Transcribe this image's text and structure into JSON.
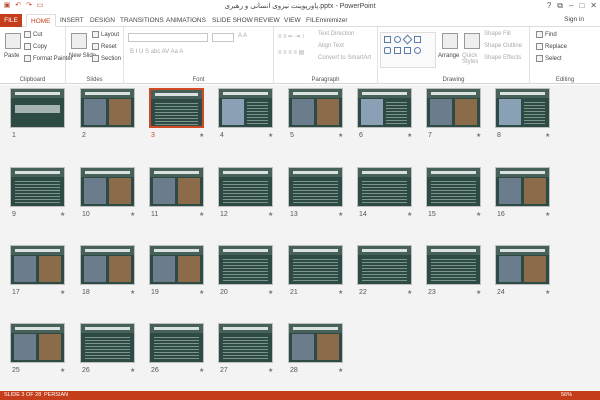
{
  "window": {
    "title": "پاورپوینت نیروی انسانی و رهبری.pptx - PowerPoint",
    "signin": "Sign in"
  },
  "qat_icons": [
    "save-icon",
    "undo-icon",
    "redo-icon",
    "present-icon"
  ],
  "tabs": [
    {
      "label": "FILE",
      "kind": "file"
    },
    {
      "label": "HOME",
      "kind": "active"
    },
    {
      "label": "INSERT"
    },
    {
      "label": "DESIGN"
    },
    {
      "label": "TRANSITIONS"
    },
    {
      "label": "ANIMATIONS"
    },
    {
      "label": "SLIDE SHOW"
    },
    {
      "label": "REVIEW"
    },
    {
      "label": "VIEW"
    },
    {
      "label": "FILEminimizer"
    }
  ],
  "ribbon": {
    "clipboard": {
      "label": "Clipboard",
      "paste": "Paste",
      "cut": "Cut",
      "copy": "Copy",
      "format_painter": "Format Painter"
    },
    "slides": {
      "label": "Slides",
      "new_slide": "New Slide",
      "layout": "Layout",
      "reset": "Reset",
      "section": "Section"
    },
    "font": {
      "label": "Font"
    },
    "paragraph": {
      "label": "Paragraph",
      "text_direction": "Text Direction",
      "align_text": "Align Text",
      "convert_smartart": "Convert to SmartArt"
    },
    "drawing": {
      "label": "Drawing",
      "arrange": "Arrange",
      "quick_styles": "Quick Styles",
      "shape_fill": "Shape Fill",
      "shape_outline": "Shape Outline",
      "shape_effects": "Shape Effects"
    },
    "editing": {
      "label": "Editing",
      "find": "Find",
      "replace": "Replace",
      "select": "Select"
    }
  },
  "slides": [
    {
      "n": "1",
      "star": false,
      "kind": "title",
      "selected": false
    },
    {
      "n": "2",
      "star": false,
      "kind": "pic",
      "selected": false
    },
    {
      "n": "3",
      "star": true,
      "kind": "text",
      "selected": true
    },
    {
      "n": "4",
      "star": true,
      "kind": "diagram",
      "selected": false
    },
    {
      "n": "5",
      "star": true,
      "kind": "pic",
      "selected": false
    },
    {
      "n": "6",
      "star": true,
      "kind": "diagram",
      "selected": false
    },
    {
      "n": "7",
      "star": true,
      "kind": "pic",
      "selected": false
    },
    {
      "n": "8",
      "star": true,
      "kind": "diagram",
      "selected": false
    },
    {
      "n": "9",
      "star": true,
      "kind": "text",
      "selected": false
    },
    {
      "n": "10",
      "star": true,
      "kind": "pic",
      "selected": false
    },
    {
      "n": "11",
      "star": true,
      "kind": "pic",
      "selected": false
    },
    {
      "n": "12",
      "star": true,
      "kind": "text",
      "selected": false
    },
    {
      "n": "13",
      "star": true,
      "kind": "text",
      "selected": false
    },
    {
      "n": "14",
      "star": true,
      "kind": "text",
      "selected": false
    },
    {
      "n": "15",
      "star": true,
      "kind": "text",
      "selected": false
    },
    {
      "n": "16",
      "star": true,
      "kind": "pic",
      "selected": false
    },
    {
      "n": "17",
      "star": true,
      "kind": "pic",
      "selected": false
    },
    {
      "n": "18",
      "star": true,
      "kind": "pic",
      "selected": false
    },
    {
      "n": "19",
      "star": true,
      "kind": "pic",
      "selected": false
    },
    {
      "n": "20",
      "star": true,
      "kind": "text",
      "selected": false
    },
    {
      "n": "21",
      "star": true,
      "kind": "text",
      "selected": false
    },
    {
      "n": "22",
      "star": true,
      "kind": "text",
      "selected": false
    },
    {
      "n": "23",
      "star": true,
      "kind": "text",
      "selected": false
    },
    {
      "n": "24",
      "star": true,
      "kind": "pic",
      "selected": false
    },
    {
      "n": "25",
      "star": true,
      "kind": "pic",
      "selected": false
    },
    {
      "n": "26",
      "star": true,
      "kind": "text",
      "selected": false
    },
    {
      "n": "26",
      "star": true,
      "kind": "text",
      "selected": false
    },
    {
      "n": "27",
      "star": true,
      "kind": "text",
      "selected": false
    },
    {
      "n": "28",
      "star": true,
      "kind": "pic",
      "selected": false
    }
  ],
  "status": {
    "slide": "SLIDE 3 OF 28",
    "language": "PERSIAN",
    "zoom": "56%"
  }
}
